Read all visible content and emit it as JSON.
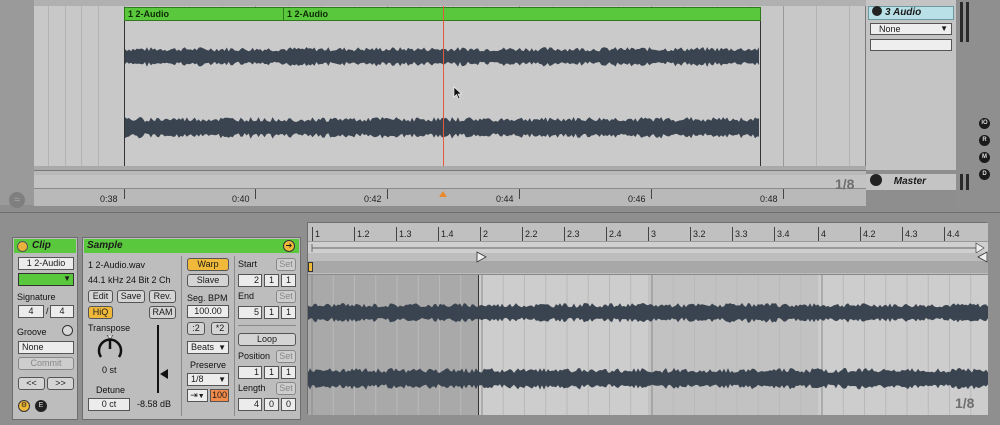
{
  "arrangement": {
    "clips": [
      {
        "label": "1 2-Audio"
      },
      {
        "label": "1 2-Audio"
      }
    ],
    "ruler_times": [
      "0:38",
      "0:40",
      "0:42",
      "0:44",
      "0:46",
      "0:48"
    ],
    "zoom": "1/8"
  },
  "mixer": {
    "track_name": "3 Audio",
    "input_select": "None",
    "master_label": "Master"
  },
  "side_buttons": [
    "IO",
    "R",
    "M",
    "D"
  ],
  "clip_panel": {
    "title": "Clip",
    "name": "1 2-Audio",
    "color": "#5ac83c",
    "signature_label": "Signature",
    "sig_num": "4",
    "sig_den": "4",
    "groove_label": "Groove",
    "groove_value": "None",
    "commit_label": "Commit",
    "nav_left": "<<",
    "nav_right": ">>"
  },
  "sample_panel": {
    "title": "Sample",
    "filename": "1 2-Audio.wav",
    "format": "44.1 kHz 24 Bit 2 Ch",
    "edit": "Edit",
    "save": "Save",
    "rev": "Rev.",
    "hiq": "HiQ",
    "ram": "RAM",
    "transpose_label": "Transpose",
    "transpose_value": "0 st",
    "detune_label": "Detune",
    "detune_value": "0 ct",
    "gain_value": "-8.58 dB",
    "warp": "Warp",
    "slave": "Slave",
    "seg_bpm_label": "Seg. BPM",
    "seg_bpm": "100.00",
    "half": ":2",
    "double": "*2",
    "warp_mode": "Beats",
    "preserve_label": "Preserve",
    "preserve_value": "1/8",
    "transient_loop": "⇥",
    "envelope": "100",
    "start_label": "Start",
    "start": [
      "2",
      "1",
      "1"
    ],
    "end_label": "End",
    "end": [
      "5",
      "1",
      "1"
    ],
    "set": "Set",
    "loop": "Loop",
    "position_label": "Position",
    "position": [
      "1",
      "1",
      "1"
    ],
    "length_label": "Length",
    "length": [
      "4",
      "0",
      "0"
    ]
  },
  "editor": {
    "ruler": [
      "1",
      "1.2",
      "1.3",
      "1.4",
      "2",
      "2.2",
      "2.3",
      "2.4",
      "3",
      "3.2",
      "3.3",
      "3.4",
      "4",
      "4.2",
      "4.3",
      "4.4"
    ],
    "zoom": "1/8"
  }
}
